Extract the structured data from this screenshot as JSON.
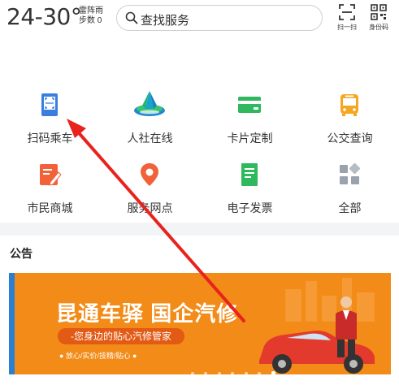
{
  "header": {
    "temperature": "24-30°",
    "weather": "雷阵雨",
    "steps": "步数 0",
    "search_placeholder": "查找服务",
    "scan_label": "扫一扫",
    "idcode_label": "身份码"
  },
  "services": [
    {
      "label": "扫码乘车",
      "icon": "bus-card-scan-icon"
    },
    {
      "label": "人社在线",
      "icon": "social-security-logo-icon"
    },
    {
      "label": "卡片定制",
      "icon": "card-icon"
    },
    {
      "label": "公交查询",
      "icon": "bus-icon"
    },
    {
      "label": "市民商城",
      "icon": "mall-icon"
    },
    {
      "label": "服务网点",
      "icon": "location-pin-icon"
    },
    {
      "label": "电子发票",
      "icon": "invoice-icon"
    },
    {
      "label": "全部",
      "icon": "all-apps-icon"
    }
  ],
  "notice": {
    "title": "公告"
  },
  "banner": {
    "title": "昆通车驿  国企汽修",
    "subtitle": "-您身边的贴心汽修管家",
    "features": "● 放心/实价/技精/贴心 ●"
  },
  "colors": {
    "banner_orange": "#f28b17",
    "arrow_red": "#e8231e",
    "icon_blue": "#3a7fe0",
    "icon_green": "#2fb85e",
    "icon_yellow": "#f5a623",
    "icon_orange": "#f2623a"
  }
}
